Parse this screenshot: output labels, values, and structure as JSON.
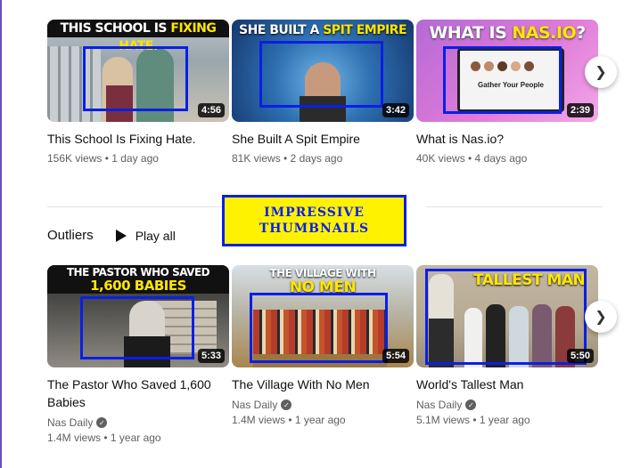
{
  "row1": [
    {
      "caption_a": "THIS SCHOOL IS ",
      "caption_b": "FIXING HATE.",
      "duration": "4:56",
      "title": "This School Is Fixing Hate.",
      "meta": "156K views • 1 day ago"
    },
    {
      "caption_a": "SHE BUILT A ",
      "caption_b": "SPIT EMPIRE",
      "duration": "3:42",
      "title": "She Built A Spit Empire",
      "meta": "81K views • 2 days ago"
    },
    {
      "caption_a": "WHAT IS ",
      "caption_b": "NAS.IO",
      "caption_c": "?",
      "screen_text": "Gather Your People",
      "duration": "2:39",
      "title": "What is Nas.io?",
      "meta": "40K views • 4 days ago"
    }
  ],
  "section": {
    "title": "Outliers",
    "play_all": "Play all"
  },
  "banner": {
    "line1": "IMPRESSIVE",
    "line2": "THUMBNAILS"
  },
  "row2": [
    {
      "caption_a": "THE PASTOR WHO SAVED",
      "caption_b": "1,600 BABIES",
      "duration": "5:33",
      "title": "The Pastor Who Saved 1,600 Babies",
      "channel": "Nas Daily",
      "meta": "1.4M views • 1 year ago"
    },
    {
      "caption_a": "THE VILLAGE WITH",
      "caption_b": "NO MEN",
      "duration": "5:54",
      "title": "The Village With No Men",
      "channel": "Nas Daily",
      "meta": "1.4M views • 1 year ago"
    },
    {
      "caption_a": "TALLEST MAN",
      "duration": "5:50",
      "title": "World's Tallest Man",
      "channel": "Nas Daily",
      "meta": "5.1M views • 1 year ago"
    }
  ],
  "icons": {
    "next": "chevron-right-icon",
    "play": "play-icon",
    "verified": "verified-check-icon"
  },
  "colors": {
    "highlight_box": "#0a1fe6",
    "banner_bg": "#fff200",
    "caption_yellow": "#ffe600"
  }
}
